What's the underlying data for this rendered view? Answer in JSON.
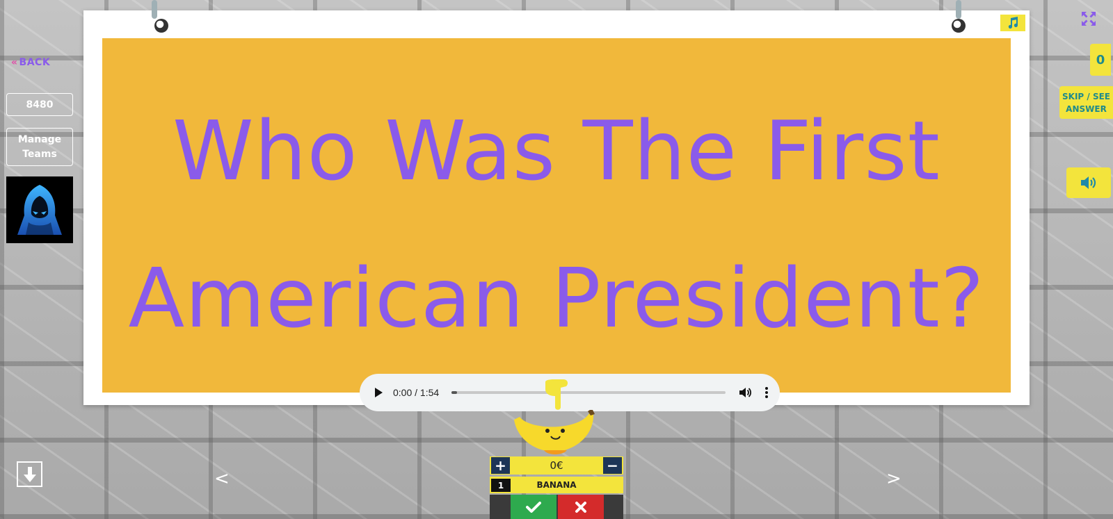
{
  "nav": {
    "back_label": "BACK",
    "back_chevron": "«"
  },
  "sidebar": {
    "score": "8480",
    "manage_teams_label": "Manage Teams",
    "avatar_icon": "hooded-figure-icon"
  },
  "question": {
    "text": "Who Was The First American President?",
    "card_color": "#f1b83b",
    "text_color": "#8a5bea"
  },
  "audio_player": {
    "time": "0:00 / 1:54",
    "progress": 0
  },
  "right_panel": {
    "counter": "0",
    "skip_label": "SKIP / SEE ANSWER"
  },
  "team": {
    "money": "0€",
    "plus_label": "+",
    "minus_label": "−",
    "rank": "1",
    "name": "BANANA"
  },
  "carousel": {
    "prev_label": "<",
    "next_label": ">"
  },
  "colors": {
    "accent_yellow": "#f3e43c",
    "accent_purple": "#8a5bea",
    "teal_text": "#1f8a8c",
    "correct_green": "#2eaa4e",
    "wrong_red": "#d42b2b"
  }
}
